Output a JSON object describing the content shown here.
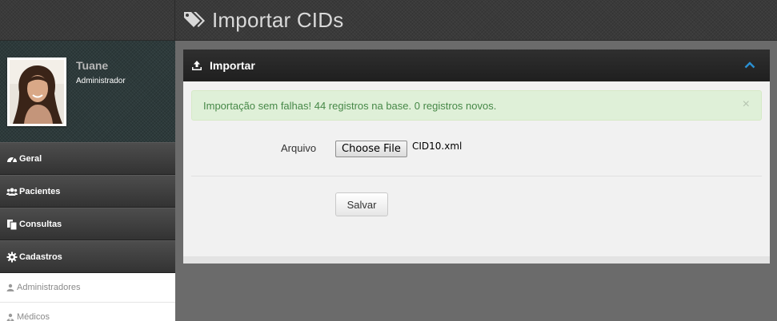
{
  "header": {
    "title": "Importar CIDs",
    "icon": "tags-icon"
  },
  "user": {
    "name": "Tuane",
    "role": "Administrador"
  },
  "sidebar": {
    "items": [
      {
        "label": "Geral",
        "icon": "dashboard-icon"
      },
      {
        "label": "Pacientes",
        "icon": "users-icon"
      },
      {
        "label": "Consultas",
        "icon": "copy-icon"
      },
      {
        "label": "Cadastros",
        "icon": "gear-icon"
      }
    ],
    "subitems": [
      {
        "label": "Administradores",
        "icon": "user-icon"
      },
      {
        "label": "Médicos",
        "icon": "user-md-icon"
      }
    ]
  },
  "panel": {
    "title": "Importar",
    "alert": "Importação sem falhas! 44 registros na base. 0 registros novos.",
    "close_glyph": "×",
    "file_label": "Arquivo",
    "file_button": "Choose File",
    "file_name": "CID10.xml",
    "save_label": "Salvar"
  },
  "colors": {
    "accent": "#2a8fd1",
    "alert_bg": "#dff0d8",
    "alert_text": "#468847"
  }
}
